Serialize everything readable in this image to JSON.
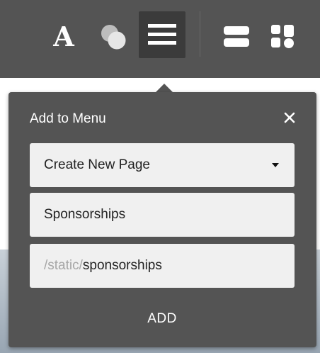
{
  "toolbar": {
    "font_glyph": "A",
    "icons": [
      "font-icon",
      "theme-colors-icon",
      "menu-icon",
      "sections-icon",
      "blocks-icon"
    ]
  },
  "popover": {
    "title": "Add to Menu",
    "close_glyph": "✕",
    "page_select": {
      "selected": "Create New Page"
    },
    "page_title": {
      "value": "Sponsorships"
    },
    "url": {
      "prefix": "/static/",
      "slug": "sponsorships"
    },
    "add_label": "ADD"
  },
  "colors": {
    "toolbar_bg": "#545454",
    "active_tool_bg": "#3b3b3b",
    "field_bg": "#f0f0f0",
    "muted_text": "#a6a6a6"
  }
}
